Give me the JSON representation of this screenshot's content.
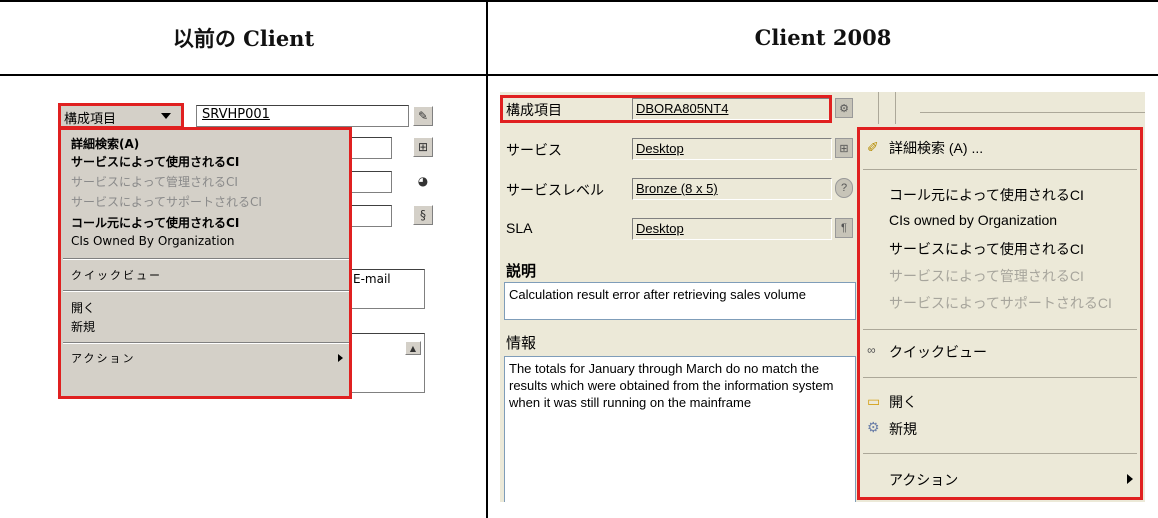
{
  "headers": {
    "left": "以前の Client",
    "right": "Client 2008"
  },
  "old_client": {
    "field_label": "構成項目",
    "field_value": "SRVHP001",
    "email_fragment": "E-mail",
    "menu": {
      "items": [
        {
          "label": "詳細検索(A)",
          "state": "bold"
        },
        {
          "label": "サービスによって使用されるCI",
          "state": "bold"
        },
        {
          "label": "サービスによって管理されるCI",
          "state": "disabled"
        },
        {
          "label": "サービスによってサポートされるCI",
          "state": "disabled"
        },
        {
          "label": "コール元によって使用されるCI",
          "state": "bold"
        },
        {
          "label": "CIs Owned By Organization",
          "state": "normal"
        },
        {
          "label": "クイックビュー",
          "state": "normal"
        },
        {
          "label": "開く",
          "state": "normal"
        },
        {
          "label": "新規",
          "state": "normal"
        },
        {
          "label": "アクション",
          "state": "normal"
        }
      ]
    }
  },
  "new_client": {
    "fields": [
      {
        "label": "構成項目",
        "value": "DBORA805NT4"
      },
      {
        "label": "サービス",
        "value": "Desktop"
      },
      {
        "label": "サービスレベル",
        "value": "Bronze (8 x 5)"
      },
      {
        "label": "SLA",
        "value": "Desktop"
      }
    ],
    "description_label": "説明",
    "description_text": "Calculation result error after retrieving sales volume",
    "info_label": "情報",
    "info_text": "The totals for January through March do no match the results which were obtained from the information system when it was still running on the mainframe",
    "menu": {
      "items": [
        {
          "label": "詳細検索 (A) ...",
          "icon": "search-wand-icon"
        },
        {
          "label": "コール元によって使用されるCI"
        },
        {
          "label": "CIs owned by Organization"
        },
        {
          "label": "サービスによって使用されるCI"
        },
        {
          "label": "サービスによって管理されるCI"
        },
        {
          "label": "サービスによってサポートされるCI"
        },
        {
          "label": "クイックビュー",
          "icon": "glasses-icon"
        },
        {
          "label": "開く",
          "icon": "folder-icon"
        },
        {
          "label": "新規",
          "icon": "new-item-icon"
        },
        {
          "label": "アクション"
        }
      ]
    }
  },
  "colors": {
    "highlight": "#e02020",
    "old_menu_bg": "#d4d0c8",
    "new_menu_bg": "#ece9d8"
  }
}
